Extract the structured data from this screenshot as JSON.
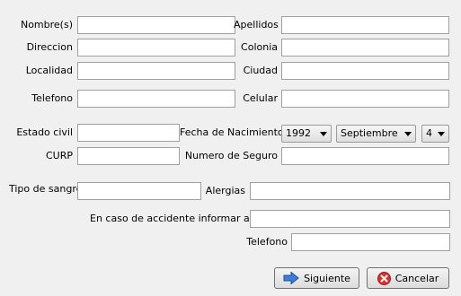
{
  "labels": {
    "nombres": "Nombre(s)",
    "apellidos": "Apellidos",
    "direccion": "Direccion",
    "colonia": "Colonia",
    "localidad": "Localidad",
    "ciudad": "Ciudad",
    "telefono": "Telefono",
    "celular": "Celular",
    "estado_civil": "Estado civil",
    "fecha_nacimiento": "Fecha de Nacimiento",
    "curp": "CURP",
    "numero_seguro": "Numero de Seguro",
    "tipo_sangre": "Tipo de sangre",
    "alergias": "Alergias",
    "en_caso_accidente": "En caso de accidente informar a",
    "telefono_emergencia": "Telefono"
  },
  "fields": {
    "nombres": "",
    "apellidos": "",
    "direccion": "",
    "colonia": "",
    "localidad": "",
    "ciudad": "",
    "telefono": "",
    "celular": "",
    "estado_civil": "",
    "curp": "",
    "numero_seguro": "",
    "tipo_sangre": "",
    "alergias": "",
    "contacto_emergencia": "",
    "telefono_emergencia": ""
  },
  "birthdate": {
    "year": "1992",
    "month": "Septiembre",
    "day": "4"
  },
  "buttons": {
    "siguiente": "Siguiente",
    "cancelar": "Cancelar"
  },
  "icons": {
    "siguiente": "arrow-right-icon",
    "cancelar": "cancel-icon"
  },
  "colors": {
    "window_bg": "#f0f0f0",
    "next_arrow": "#3b7dd8",
    "cancel_red": "#d93030"
  }
}
